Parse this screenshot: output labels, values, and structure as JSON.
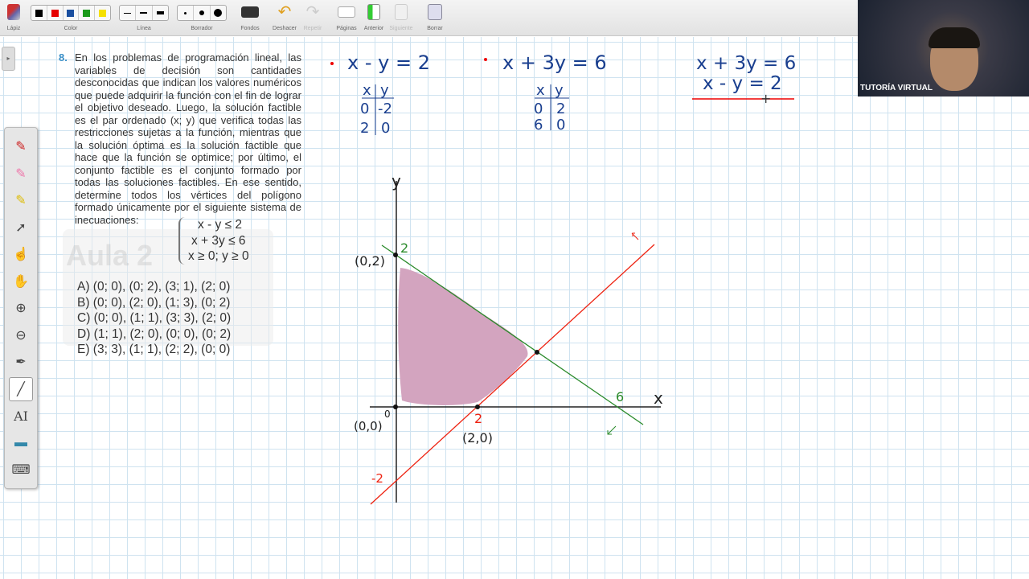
{
  "toolbar": {
    "pencil": "Lápiz",
    "color": "Color",
    "line": "Línea",
    "eraser": "Borrador",
    "backgrounds": "Fondos",
    "undo": "Deshacer",
    "redo": "Repetir",
    "pages": "Páginas",
    "previous": "Anterior",
    "next": "Siguiente",
    "clear": "Borrar",
    "colors": [
      "#000000",
      "#e60000",
      "#1a4fa0",
      "#1a9a1a",
      "#f5e000"
    ]
  },
  "palette": [
    "pen-icon",
    "highlighter-pink-icon",
    "highlighter-yellow-icon",
    "pointer-icon",
    "hand-point-icon",
    "hand-icon",
    "zoom-in-icon",
    "zoom-out-icon",
    "eyedropper-icon",
    "line-icon",
    "text-icon",
    "screen-icon",
    "keyboard-icon"
  ],
  "palette_text_tool": "AI",
  "problem": {
    "number": "8.",
    "text": "En los problemas de programación lineal, las variables de decisión son cantidades desconocidas que indican los valores numéricos que puede adquirir la función con el fin de lograr el objetivo deseado. Luego, la solución factible es el par ordenado (x; y) que verifica todas las restricciones sujetas a la función, mientras que la solución óptima es la solución factible que hace que la función se optimice; por último, el conjunto factible es el conjunto formado por todas las soluciones factibles. En ese sentido, determine todos los vértices del polígono formado únicamente por el siguiente sistema de inecuaciones:",
    "system": [
      "x - y ≤ 2",
      "x + 3y ≤ 6",
      "x ≥ 0; y ≥ 0"
    ],
    "options": [
      "A)  (0; 0), (0; 2), (3; 1), (2; 0)",
      "B)  (0; 0), (2; 0), (1; 3), (0; 2)",
      "C)  (0; 0), (1; 1), (3; 3), (2; 0)",
      "D)  (1; 1), (2; 0), (0; 0), (0; 2)",
      "E)  (3; 3), (1; 1), (2; 2), (0; 0)"
    ],
    "watermark": "Aula 2"
  },
  "notes": {
    "eq1": "x - y = 2",
    "eq2": "x + 3y = 6",
    "table1": {
      "head": [
        "x",
        "y"
      ],
      "rows": [
        [
          "0",
          "-2"
        ],
        [
          "2",
          "0"
        ]
      ]
    },
    "table2": {
      "head": [
        "x",
        "y"
      ],
      "rows": [
        [
          "0",
          "2"
        ],
        [
          "6",
          "0"
        ]
      ]
    },
    "system": [
      "x + 3y = 6",
      "x - y = 2"
    ]
  },
  "graph": {
    "x_axis": "x",
    "y_axis": "y",
    "labels": {
      "p02": "(0,2)",
      "y2": "2",
      "origin": "(0,0)",
      "zero": "0",
      "x2": "2",
      "p20": "(2,0)",
      "x6": "6",
      "ym2": "-2"
    }
  },
  "webcam": {
    "caption": "TUTORÍA VIRTUAL"
  }
}
